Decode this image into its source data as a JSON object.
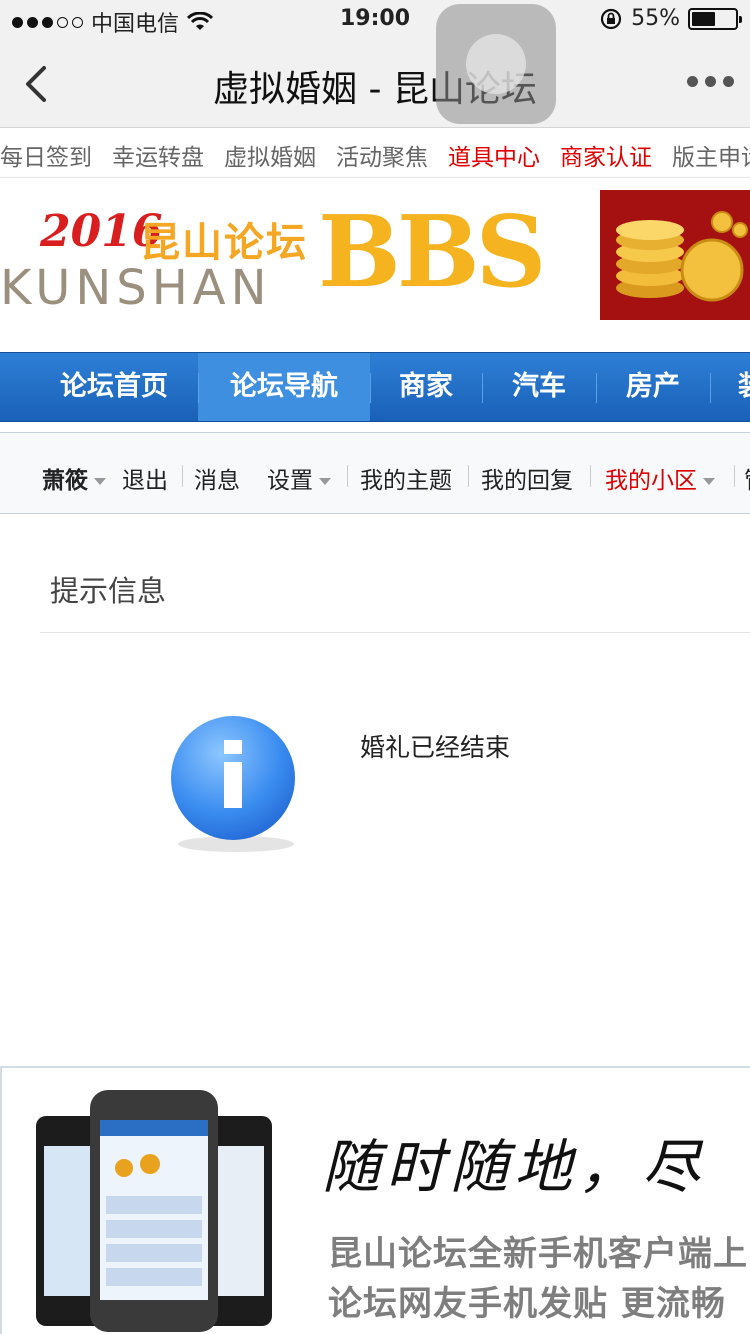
{
  "status_bar": {
    "carrier": "中国电信",
    "time": "19:00",
    "battery": "55%",
    "battery_level": 0.55,
    "signal_bars_full": 3,
    "signal_bars_total": 5
  },
  "nav": {
    "title": "虚拟婚姻 - 昆山论坛"
  },
  "quick_links": [
    {
      "label": "每日签到",
      "color": "#666666"
    },
    {
      "label": "幸运转盘",
      "color": "#666666"
    },
    {
      "label": "虚拟婚姻",
      "color": "#666666"
    },
    {
      "label": "活动聚焦",
      "color": "#666666"
    },
    {
      "label": "道具中心",
      "color": "#e00000"
    },
    {
      "label": "商家认证",
      "color": "#e00000"
    },
    {
      "label": "版主申请",
      "color": "#666666"
    }
  ],
  "banner": {
    "year": "2016",
    "brand_cn": "昆山论坛",
    "brand_en": "KUNSHAN",
    "brand_bbs": "BBS"
  },
  "main_nav": [
    "论坛首页",
    "论坛导航",
    "商家",
    "汽车",
    "房产",
    "装修"
  ],
  "main_nav_active": "论坛导航",
  "user_bar": {
    "username": "萧筱",
    "logout": "退出",
    "messages": "消息",
    "settings": "设置",
    "my_topics": "我的主题",
    "my_replies": "我的回复",
    "my_community": "我的小区",
    "more": "管"
  },
  "message": {
    "title": "提示信息",
    "text": "婚礼已经结束"
  },
  "bottom_ad": {
    "slogan": "随时随地，尽",
    "line1": "昆山论坛全新手机客户端上",
    "line2": "论坛网友手机发贴 更流畅"
  },
  "colors": {
    "nav_blue": "#1a61b8",
    "link_red": "#e00000",
    "brand_orange": "#f5a623"
  }
}
